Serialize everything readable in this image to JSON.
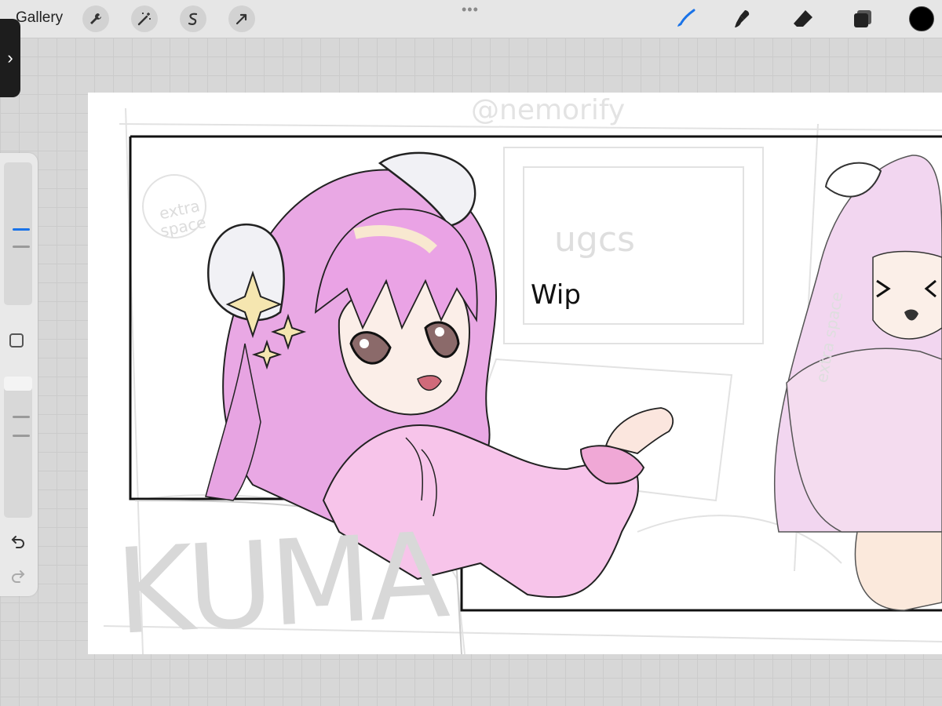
{
  "toolbar": {
    "gallery_label": "Gallery",
    "left_tools": [
      {
        "icon": "wrench-icon"
      },
      {
        "icon": "magic-wand-icon"
      },
      {
        "icon": "selection-icon"
      },
      {
        "icon": "transform-arrow-icon"
      }
    ],
    "more_dots": "•••",
    "right_tools": [
      {
        "icon": "brush-icon",
        "active": true,
        "color": "#1a73e8"
      },
      {
        "icon": "smudge-icon"
      },
      {
        "icon": "eraser-icon"
      },
      {
        "icon": "layers-icon"
      }
    ],
    "current_color": "#000000"
  },
  "sidebar": {
    "expand_glyph": "›",
    "undo_glyph": "↶",
    "redo_glyph": "↷"
  },
  "canvas": {
    "watermark": "@nemorify",
    "wip_text": "Wip",
    "sketch_monitor_text": "ugcs",
    "sketch_left_text": "extra space",
    "sketch_right_text": "extra space",
    "sketch_big_text": "KUMA"
  }
}
